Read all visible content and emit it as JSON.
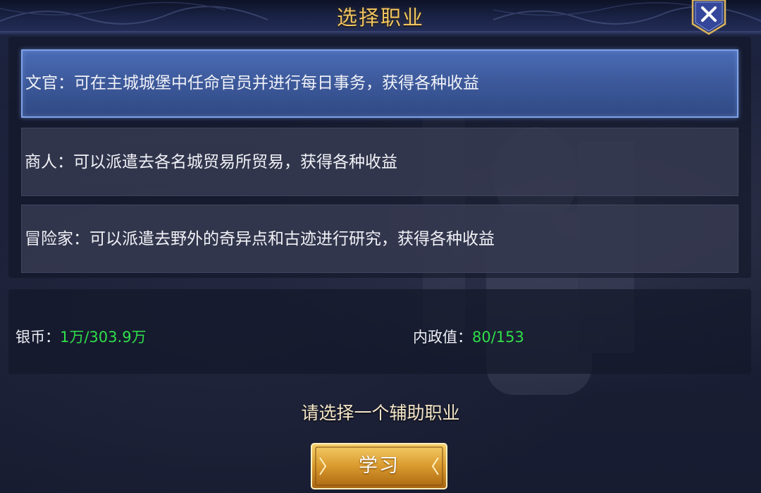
{
  "dialog": {
    "title": "选择职业",
    "close_icon": "close-icon"
  },
  "options": [
    {
      "label": "文官：可在主城城堡中任命官员并进行每日事务，获得各种收益",
      "selected": true
    },
    {
      "label": "商人：可以派遣去各名城贸易所贸易，获得各种收益",
      "selected": false
    },
    {
      "label": "冒险家：可以派遣去野外的奇异点和古迹进行研究，获得各种收益",
      "selected": false
    }
  ],
  "stats": {
    "silver_label": "银币：",
    "silver_value": "1万/303.9万",
    "politics_label": "内政值：",
    "politics_value": "80/153"
  },
  "prompt": "请选择一个辅助职业",
  "learn_button": "学习",
  "colors": {
    "title_gold": "#f2c560",
    "selected_blue": "#3d5a9c",
    "value_green": "#2fe04a"
  }
}
